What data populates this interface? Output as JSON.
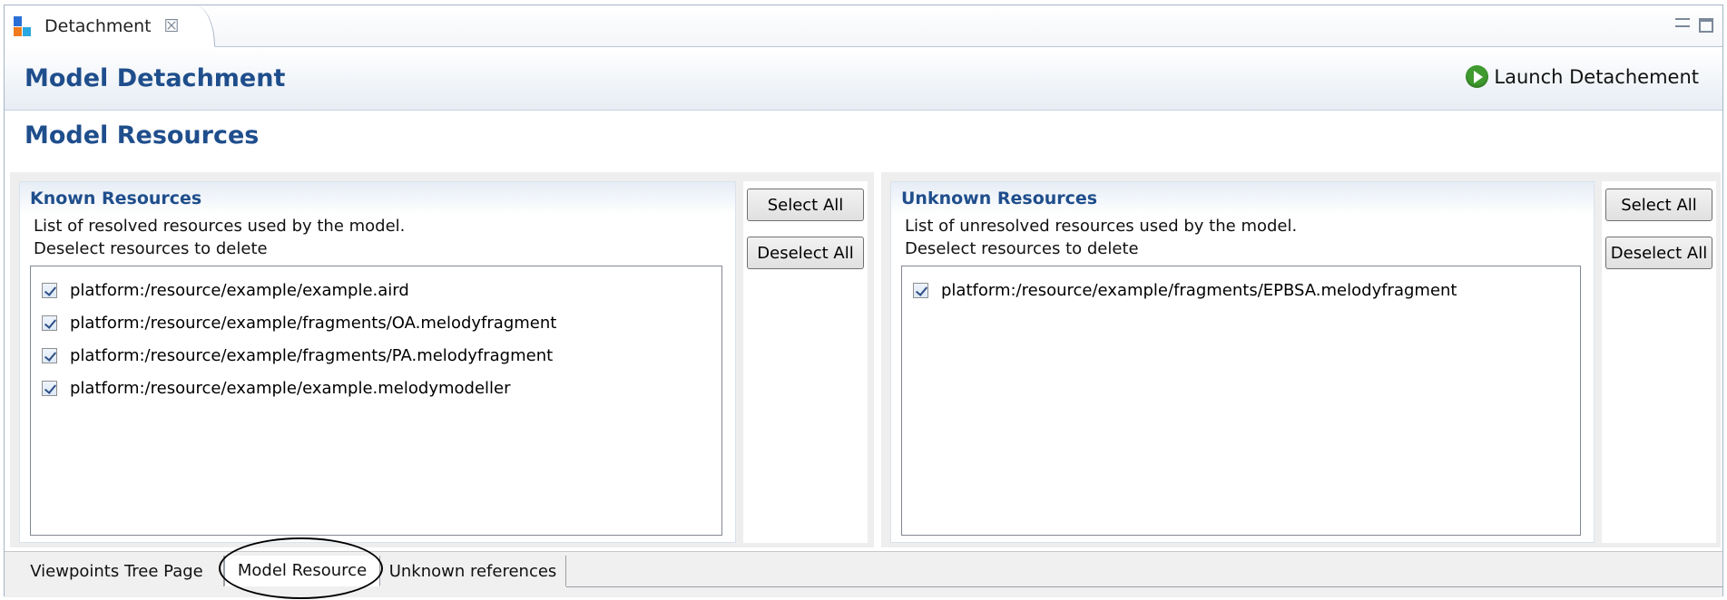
{
  "view_tab": {
    "title": "Detachment",
    "close_glyph": "☒"
  },
  "header": {
    "title": "Model Detachment",
    "launch_label": "Launch Detachement"
  },
  "page": {
    "title": "Model Resources"
  },
  "known": {
    "title": "Known Resources",
    "desc_line1": "List of resolved resources used by the model.",
    "desc_line2": "Deselect resources to delete",
    "items": [
      {
        "label": "platform:/resource/example/example.aird",
        "checked": true
      },
      {
        "label": "platform:/resource/example/fragments/OA.melodyfragment",
        "checked": true
      },
      {
        "label": "platform:/resource/example/fragments/PA.melodyfragment",
        "checked": true
      },
      {
        "label": "platform:/resource/example/example.melodymodeller",
        "checked": true
      }
    ],
    "select_all": "Select All",
    "deselect_all": "Deselect All"
  },
  "unknown": {
    "title": "Unknown Resources",
    "desc_line1": "List of unresolved resources used by the model.",
    "desc_line2": "Deselect resources to delete",
    "items": [
      {
        "label": "platform:/resource/example/fragments/EPBSA.melodyfragment",
        "checked": true
      }
    ],
    "select_all": "Select All",
    "deselect_all": "Deselect All"
  },
  "page_tabs": [
    {
      "label": "Viewpoints Tree Page"
    },
    {
      "label": "Model Resource",
      "active": true
    },
    {
      "label": "Unknown references"
    }
  ],
  "colors": {
    "title_blue": "#1f4e8c",
    "launch_green": "#3f9b2f"
  },
  "icons": [
    "app-icon",
    "close-icon",
    "minimize-icon",
    "maximize-icon",
    "play-icon",
    "checkbox-icon"
  ]
}
